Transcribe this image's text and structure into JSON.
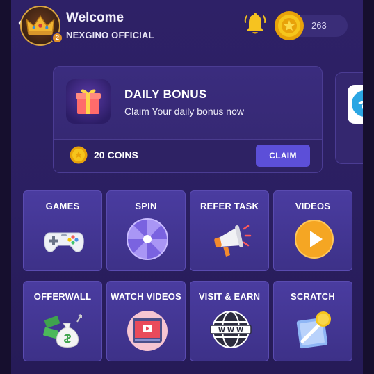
{
  "header": {
    "welcome_text": "Welcome",
    "username": "NEXGINO OFFICIAL",
    "avatar_level": "2",
    "coin_balance": "263"
  },
  "daily_bonus": {
    "title": "DAILY BONUS",
    "subtitle": "Claim Your daily bonus now",
    "reward_text": "20 COINS",
    "claim_label": "CLAIM"
  },
  "grid": {
    "items": [
      {
        "label": "GAMES",
        "icon": "gamepad-icon"
      },
      {
        "label": "SPIN",
        "icon": "spin-wheel-icon"
      },
      {
        "label": "REFER TASK",
        "icon": "megaphone-icon"
      },
      {
        "label": "VIDEOS",
        "icon": "play-button-icon"
      },
      {
        "label": "OFFERWALL",
        "icon": "money-bag-icon"
      },
      {
        "label": "WATCH VIDEOS",
        "icon": "video-player-icon"
      },
      {
        "label": "VISIT & EARN",
        "icon": "globe-www-icon"
      },
      {
        "label": "SCRATCH",
        "icon": "scratch-card-icon"
      }
    ]
  },
  "colors": {
    "background": "#2e2167",
    "card": "#3a2c7e",
    "tile": "#4a3ca0",
    "accent": "#5c4fd8",
    "coin": "#f2b705"
  }
}
